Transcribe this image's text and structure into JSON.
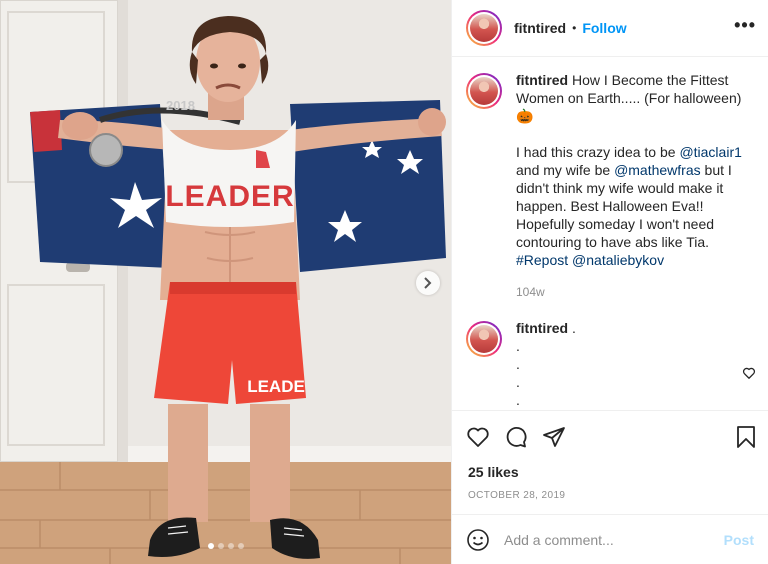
{
  "header": {
    "username": "fitntired",
    "separator": "•",
    "follow_label": "Follow",
    "more_label": "•••"
  },
  "photo": {
    "shirt_text": "LEADER",
    "shorts_text": "LEADE",
    "medal_year": "2018",
    "next_icon": "chevron-right-icon",
    "carousel_dot_count": 4,
    "carousel_active_index": 0
  },
  "caption": {
    "username": "fitntired",
    "lines": [
      "How I Become the Fittest Women on Earth..... (For halloween) 🎃"
    ],
    "p2_pre": "I had this crazy idea to be ",
    "mention1": "@tiaclair1",
    "p2_mid": " and my wife be ",
    "mention2": "@mathewfras",
    "p2_post": " but I didn't think my wife would make it happen. Best Halloween Eva!! Hopefully someday I won't need contouring to have abs like Tia.",
    "hashtag": "#Repost",
    "mention3": "@nataliebykov",
    "time": "104w"
  },
  "comment2": {
    "username": "fitntired",
    "text": ".",
    "dots": [
      ".",
      ".",
      ".",
      ".",
      "."
    ],
    "like_icon": "heart-outline-icon"
  },
  "actions": {
    "like_icon": "heart-icon",
    "comment_icon": "comment-icon",
    "share_icon": "paper-plane-icon",
    "save_icon": "bookmark-icon"
  },
  "likes": "25 likes",
  "date": "OCTOBER 28, 2019",
  "add_comment": {
    "placeholder": "Add a comment...",
    "post_label": "Post",
    "emoji_icon": "smiley-icon"
  },
  "colors": {
    "follow": "#0095f6",
    "post_disabled": "#b2dffc",
    "mention": "#00376b",
    "secondary_text": "#8e8e8e"
  }
}
